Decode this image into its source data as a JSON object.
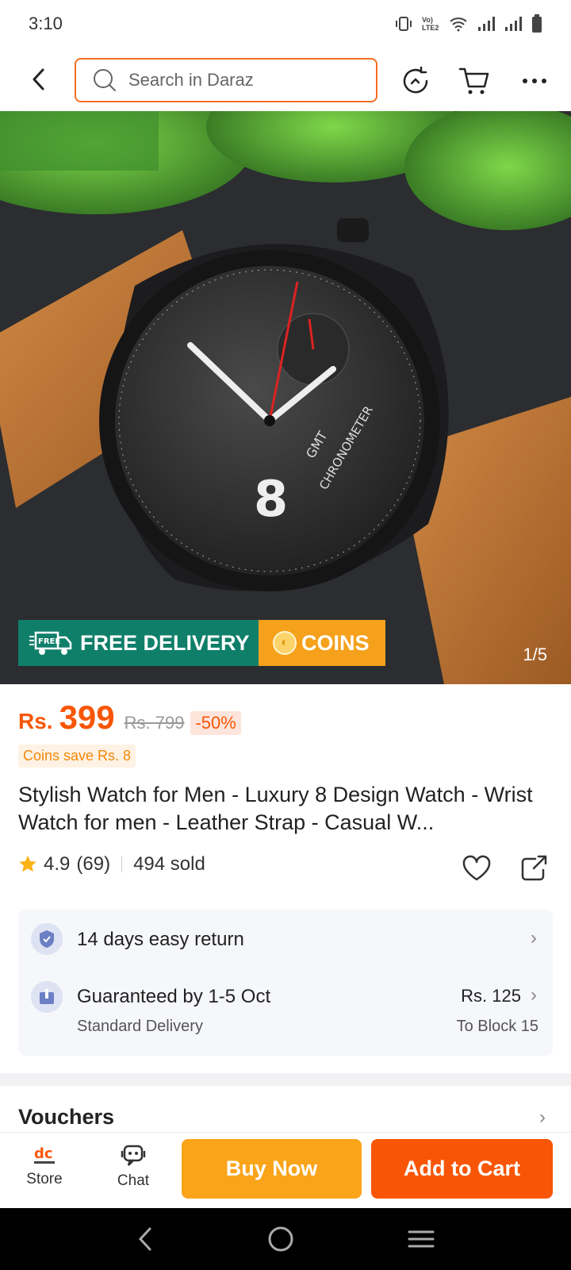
{
  "status_bar": {
    "time": "3:10",
    "network_label": "Vo) LTE2"
  },
  "search": {
    "placeholder": "Search in Daraz"
  },
  "hero": {
    "badge_delivery": "FREE DELIVERY",
    "badge_delivery_tag": "FREE",
    "badge_coins": "COINS",
    "counter": "1/5",
    "watch_text_top": "GMT",
    "watch_text": "CHRONOMETER",
    "watch_numeral": "8"
  },
  "price": {
    "currency": "Rs.",
    "amount": "399",
    "original": "Rs. 799",
    "discount": "-50%",
    "coins_save": "Coins save Rs. 8"
  },
  "product": {
    "title": "Stylish Watch for Men - Luxury 8 Design Watch - Wrist Watch for men - Leather Strap - Casual W...",
    "rating": "4.9",
    "reviews": "(69)",
    "sold": "494 sold"
  },
  "service": {
    "return_label": "14 days easy return",
    "delivery_label": "Guaranteed by 1-5 Oct",
    "delivery_type": "Standard Delivery",
    "delivery_fee": "Rs. 125",
    "delivery_to": "To Block 15"
  },
  "vouchers": {
    "label": "Vouchers"
  },
  "bottom_bar": {
    "store_label": "Store",
    "chat_label": "Chat",
    "buy_now": "Buy Now",
    "add_to_cart": "Add to Cart"
  },
  "colors": {
    "brand_orange": "#f85606",
    "buy_now": "#faa41a",
    "delivery_badge": "#0f7f6a",
    "coins_badge": "#f5a11c"
  }
}
